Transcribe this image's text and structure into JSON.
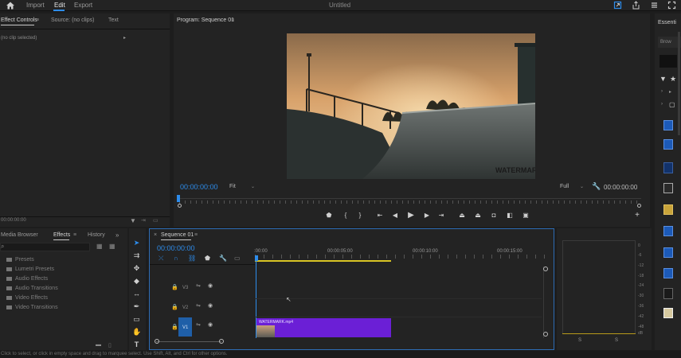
{
  "topbar": {
    "menus": [
      "Import",
      "Edit",
      "Export"
    ],
    "active_menu": "Edit",
    "document_title": "Untitled"
  },
  "effect_controls": {
    "tabs": [
      "Effect Controls",
      "Source: (no clips)",
      "Text"
    ],
    "no_clip": "(no clip selected)",
    "timecode": "00:00:00:00"
  },
  "program": {
    "title": "Program: Sequence 01",
    "timecode_left": "00:00:00:00",
    "fit": "Fit",
    "quality": "Full",
    "timecode_right": "00:00:00:00",
    "watermark": "WATERMARK"
  },
  "media_browser": {
    "tabs": [
      "Media Browser",
      "Effects",
      "History"
    ],
    "active_tab": "Effects",
    "items": [
      "Presets",
      "Lumetri Presets",
      "Audio Effects",
      "Audio Transitions",
      "Video Effects",
      "Video Transitions"
    ]
  },
  "timeline": {
    "tab": "Sequence 01",
    "timecode": "00:00:00:00",
    "ruler": [
      ":00:00",
      "00:00:05:00",
      "00:00:10:00",
      "00:00:15:00"
    ],
    "tracks": [
      "V3",
      "V2",
      "V1"
    ],
    "clip_name": "WATERMARK.mp4"
  },
  "meter": {
    "scale": [
      "0",
      "-6",
      "-12",
      "-18",
      "-24",
      "-30",
      "-36",
      "-42",
      "-48",
      "dB"
    ],
    "channels": [
      "S",
      "S"
    ]
  },
  "essential_graphics": {
    "title": "Essenti",
    "browse": "Brow"
  },
  "status": {
    "text": "Click to select, or click in empty space and drag to marquee select. Use Shift, Alt, and Ctrl for other options."
  },
  "colors": {
    "accent": "#2d8ceb",
    "clip": "#6b1fd6",
    "panel": "#232323",
    "background": "#1d1d1d"
  }
}
